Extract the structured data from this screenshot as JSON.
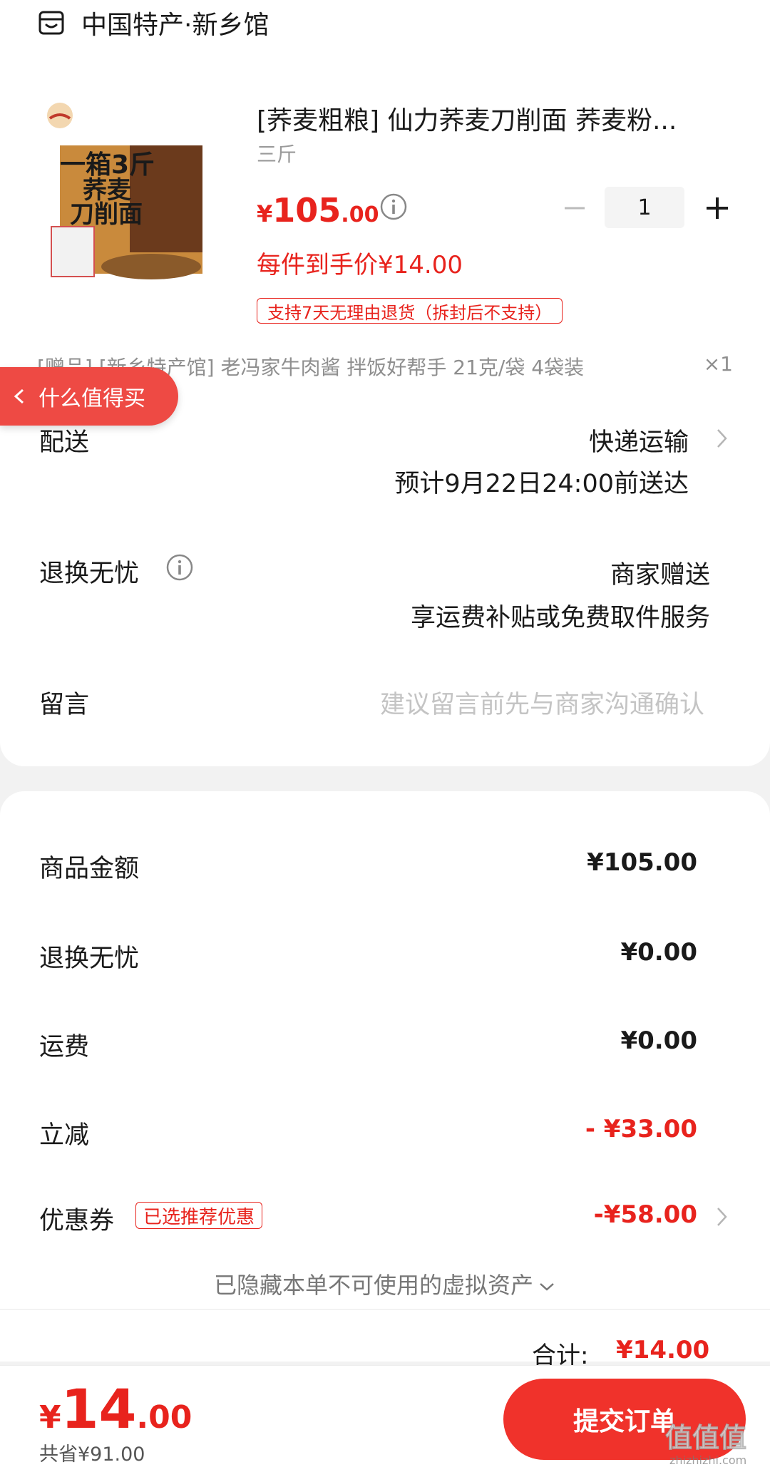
{
  "shop": {
    "name": "中国特产·新乡馆",
    "icon": "shop-icon"
  },
  "product": {
    "title": "[荞麦粗粮] 仙力荞麦刀削面  荞麦粉...",
    "spec": "三斤",
    "image_lines": [
      "一箱3斤",
      "荞麦",
      "刀削面"
    ],
    "price_symbol": "¥",
    "price_int": "105",
    "price_dec": ".00",
    "quantity": "1",
    "unit_price": "每件到手价¥14.00",
    "return_tag": "支持7天无理由退货（拆封后不支持）"
  },
  "gift": {
    "text": "[赠品] [新乡特产馆] 老冯家牛肉酱 拌饭好帮手 21克/袋 4袋装",
    "qty": "×1"
  },
  "floating_pill": {
    "label": "什么值得买"
  },
  "delivery": {
    "label": "配送",
    "method": "快递运输",
    "eta": "预计9月22日24:00前送达"
  },
  "worry_free": {
    "label": "退换无忧",
    "value": "商家赠送",
    "desc": "享运费补贴或免费取件服务"
  },
  "message": {
    "label": "留言",
    "placeholder": "建议留言前先与商家沟通确认"
  },
  "summary": {
    "goods_label": "商品金额",
    "goods_value": "¥105.00",
    "worry_label": "退换无忧",
    "worry_value": "¥0.00",
    "shipping_label": "运费",
    "shipping_value": "¥0.00",
    "discount_label": "立减",
    "discount_value": "- ¥33.00",
    "coupon_label": "优惠券",
    "coupon_tag": "已选推荐优惠",
    "coupon_value": "-¥58.00",
    "hidden_assets": "已隐藏本单不可使用的虚拟资产",
    "total_label": "合计:",
    "total_value": "¥14.00"
  },
  "footer": {
    "price_symbol": "¥",
    "price_int": "14",
    "price_dec": ".00",
    "saved": "共省¥91.00",
    "submit_label": "提交订单"
  },
  "watermark": {
    "text": "值值值",
    "site": "zhizhizhi.com"
  },
  "colors": {
    "accent": "#e8231d",
    "button": "#f0322b",
    "pill": "#ee4a44"
  }
}
